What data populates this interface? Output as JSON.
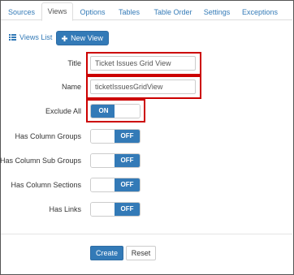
{
  "tabs": [
    "Sources",
    "Views",
    "Options",
    "Tables",
    "Table Order",
    "Settings",
    "Exceptions"
  ],
  "active_tab": "Views",
  "toolbar": {
    "views_list": "Views List",
    "new_view": "New View"
  },
  "form": {
    "title_label": "Title",
    "title_value": "Ticket Issues Grid View",
    "name_label": "Name",
    "name_value": "ticketIssuesGridView",
    "exclude_all_label": "Exclude All",
    "exclude_all_state": "ON",
    "has_column_groups_label": "Has Column Groups",
    "has_column_groups_state": "OFF",
    "has_column_sub_groups_label": "Has Column Sub Groups",
    "has_column_sub_groups_state": "OFF",
    "has_column_sections_label": "Has Column Sections",
    "has_column_sections_state": "OFF",
    "has_links_label": "Has Links",
    "has_links_state": "OFF"
  },
  "actions": {
    "create": "Create",
    "reset": "Reset"
  },
  "colors": {
    "primary": "#337ab7",
    "highlight": "#cc0000"
  }
}
